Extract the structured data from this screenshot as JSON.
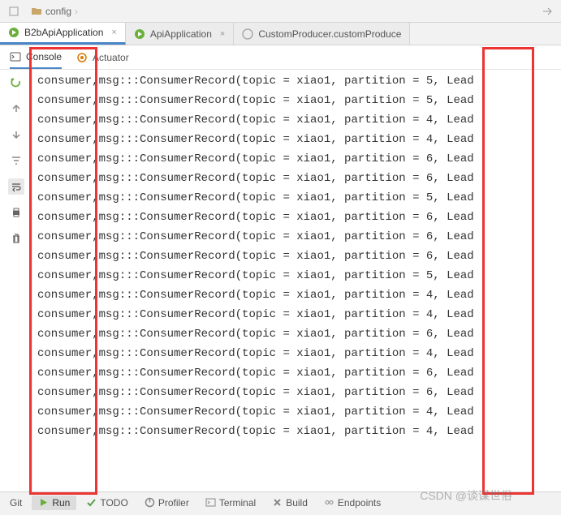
{
  "topbar": {
    "breadcrumb": "config"
  },
  "tabs": [
    {
      "label": "B2bApiApplication",
      "active": true,
      "icon_color": "#6aaf3a"
    },
    {
      "label": "ApiApplication",
      "active": false,
      "icon_color": "#6aaf3a"
    },
    {
      "label": "CustomProducer.customProduce",
      "active": false,
      "icon_color": "#888"
    }
  ],
  "sub_tabs": [
    {
      "label": "Console",
      "active": true
    },
    {
      "label": "Actuator",
      "active": false
    }
  ],
  "console": {
    "lines": [
      "consumer,msg:::ConsumerRecord(topic = xiao1, partition = 5, Lead",
      "consumer,msg:::ConsumerRecord(topic = xiao1, partition = 5, Lead",
      "consumer,msg:::ConsumerRecord(topic = xiao1, partition = 4, Lead",
      "consumer,msg:::ConsumerRecord(topic = xiao1, partition = 4, Lead",
      "consumer,msg:::ConsumerRecord(topic = xiao1, partition = 6, Lead",
      "consumer,msg:::ConsumerRecord(topic = xiao1, partition = 6, Lead",
      "consumer,msg:::ConsumerRecord(topic = xiao1, partition = 5, Lead",
      "consumer,msg:::ConsumerRecord(topic = xiao1, partition = 6, Lead",
      "consumer,msg:::ConsumerRecord(topic = xiao1, partition = 6, Lead",
      "consumer,msg:::ConsumerRecord(topic = xiao1, partition = 6, Lead",
      "consumer,msg:::ConsumerRecord(topic = xiao1, partition = 5, Lead",
      "consumer,msg:::ConsumerRecord(topic = xiao1, partition = 4, Lead",
      "consumer,msg:::ConsumerRecord(topic = xiao1, partition = 4, Lead",
      "consumer,msg:::ConsumerRecord(topic = xiao1, partition = 6, Lead",
      "consumer,msg:::ConsumerRecord(topic = xiao1, partition = 4, Lead",
      "consumer,msg:::ConsumerRecord(topic = xiao1, partition = 6, Lead",
      "consumer,msg:::ConsumerRecord(topic = xiao1, partition = 6, Lead",
      "consumer,msg:::ConsumerRecord(topic = xiao1, partition = 4, Lead",
      "consumer,msg:::ConsumerRecord(topic = xiao1, partition = 4, Lead"
    ]
  },
  "bottom": {
    "items": [
      {
        "label": "Git",
        "icon": "git"
      },
      {
        "label": "Run",
        "icon": "run",
        "active": true
      },
      {
        "label": "TODO",
        "icon": "todo"
      },
      {
        "label": "Profiler",
        "icon": "profiler"
      },
      {
        "label": "Terminal",
        "icon": "terminal"
      },
      {
        "label": "Build",
        "icon": "build"
      },
      {
        "label": "Endpoints",
        "icon": "endpoints"
      }
    ]
  },
  "watermark": "CSDN @谈谋世俗"
}
